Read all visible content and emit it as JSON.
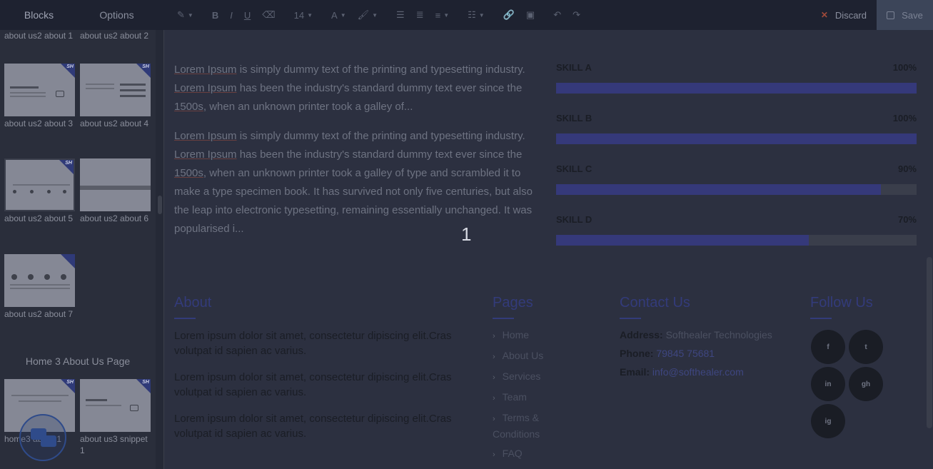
{
  "toolbar": {
    "tabs": [
      "Blocks",
      "Options"
    ],
    "font_size": "14",
    "discard_label": "Discard",
    "save_label": "Save"
  },
  "sidebar": {
    "blocks": [
      {
        "label": "about us2 about 1"
      },
      {
        "label": "about us2 about 2"
      },
      {
        "label": "about us2 about 3"
      },
      {
        "label": "about us2 about 4"
      },
      {
        "label": "about us2 about 5"
      },
      {
        "label": "about us2 about 6"
      },
      {
        "label": "about us2 about 7"
      },
      {
        "label": "home3 about 1"
      },
      {
        "label": "about us3 snippet 1"
      }
    ],
    "section_title": "Home 3 About Us Page",
    "thumb_badge": "SH"
  },
  "canvas": {
    "paragraph1": {
      "w1": "Lorem Ipsum",
      "t1": " is simply dummy text of the printing and typesetting industry. ",
      "w2": "Lorem Ipsum",
      "t2": " has been the industry's standard dummy text ever since the ",
      "w3": "1500s",
      "t3": ", when an unknown printer took a galley of..."
    },
    "paragraph2": {
      "w1": "Lorem Ipsum",
      "t1": " is simply dummy text of the printing and typesetting industry. ",
      "w2": "Lorem Ipsum",
      "t2": " has been the industry's standard dummy text ever since the ",
      "w3": "1500s",
      "t3": ", when an unknown printer took a galley of type and scrambled it to make a type specimen book. It has survived not only five centuries, but also the leap into electronic typesetting, remaining essentially unchanged. It was popularised i..."
    },
    "skills": [
      {
        "name": "SKILL A",
        "value": "100%",
        "level": 1.0
      },
      {
        "name": "SKILL B",
        "value": "100%",
        "level": 1.0
      },
      {
        "name": "SKILL C",
        "value": "90%",
        "level": 0.9
      },
      {
        "name": "SKILL D",
        "value": "70%",
        "level": 0.7
      }
    ],
    "overlay_number": "1",
    "footer": {
      "about": {
        "title": "About",
        "paragraphs": [
          "Lorem ipsum dolor sit amet, consectetur dipiscing elit.Cras volutpat id sapien ac varius.",
          "Lorem ipsum dolor sit amet, consectetur dipiscing elit.Cras volutpat id sapien ac varius.",
          "Lorem ipsum dolor sit amet, consectetur dipiscing elit.Cras volutpat id sapien ac varius."
        ]
      },
      "pages": {
        "title": "Pages",
        "items": [
          "Home",
          "About Us",
          "Services",
          "Team",
          "Terms & Conditions",
          "FAQ"
        ]
      },
      "contact": {
        "title": "Contact Us",
        "address_label": "Address:",
        "address": "Softhealer Technologies",
        "phone_label": "Phone:",
        "phone": "79845 75681",
        "email_label": "Email:",
        "email": "info@softhealer.com"
      },
      "follow": {
        "title": "Follow Us",
        "icons": [
          "f",
          "t",
          "in",
          "gh",
          "ig"
        ]
      }
    }
  },
  "colors": {
    "accent": "#35397a",
    "toolbar_bg": "#1e2230",
    "sidebar_bg": "#2a2e3b"
  }
}
